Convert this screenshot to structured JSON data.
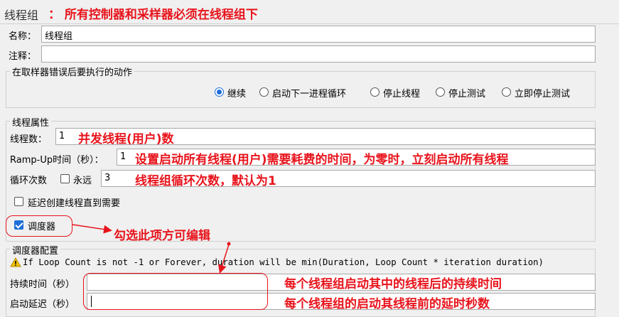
{
  "header": {
    "title": "线程组",
    "annotation": "： 所有控制器和采样器必须在线程组下"
  },
  "name": {
    "label": "名称：",
    "value": "线程组"
  },
  "comment": {
    "label": "注释：",
    "value": ""
  },
  "sampler_error": {
    "legend": "在取样器错误后要执行的动作",
    "options": [
      "继续",
      "启动下一进程循环",
      "停止线程",
      "停止测试",
      "立即停止测试"
    ],
    "selected": "继续"
  },
  "thread_props": {
    "legend": "线程属性",
    "threads_label": "线程数：",
    "threads_value": "1",
    "threads_annot": "并发线程(用户)数",
    "rampup_label": "Ramp-Up时间（秒）：",
    "rampup_value": "1",
    "rampup_annot": "设置启动所有线程(用户)需要耗费的时间，为零时，立刻启动所有线程",
    "loop_label": "循环次数",
    "forever_label": "永远",
    "loop_value": "3",
    "loop_annot": "线程组循环次数，默认为1",
    "delay_label": "延迟创建线程直到需要",
    "scheduler_label": "调度器",
    "scheduler_checked": true,
    "scheduler_annot": "勾选此项方可编辑"
  },
  "scheduler": {
    "legend": "调度器配置",
    "warning": "If Loop Count is not -1 or Forever, duration will be min(Duration, Loop Count * iteration duration)",
    "duration_label": "持续时间（秒）",
    "duration_value": "",
    "duration_annot": "每个线程组启动其中的线程后的持续时间",
    "delay_label": "启动延迟（秒）",
    "delay_value": "",
    "delay_annot": "每个线程组的启动其线程前的延时秒数"
  },
  "colors": {
    "annotation": "#e8141c",
    "accent": "#1e6fd9"
  }
}
